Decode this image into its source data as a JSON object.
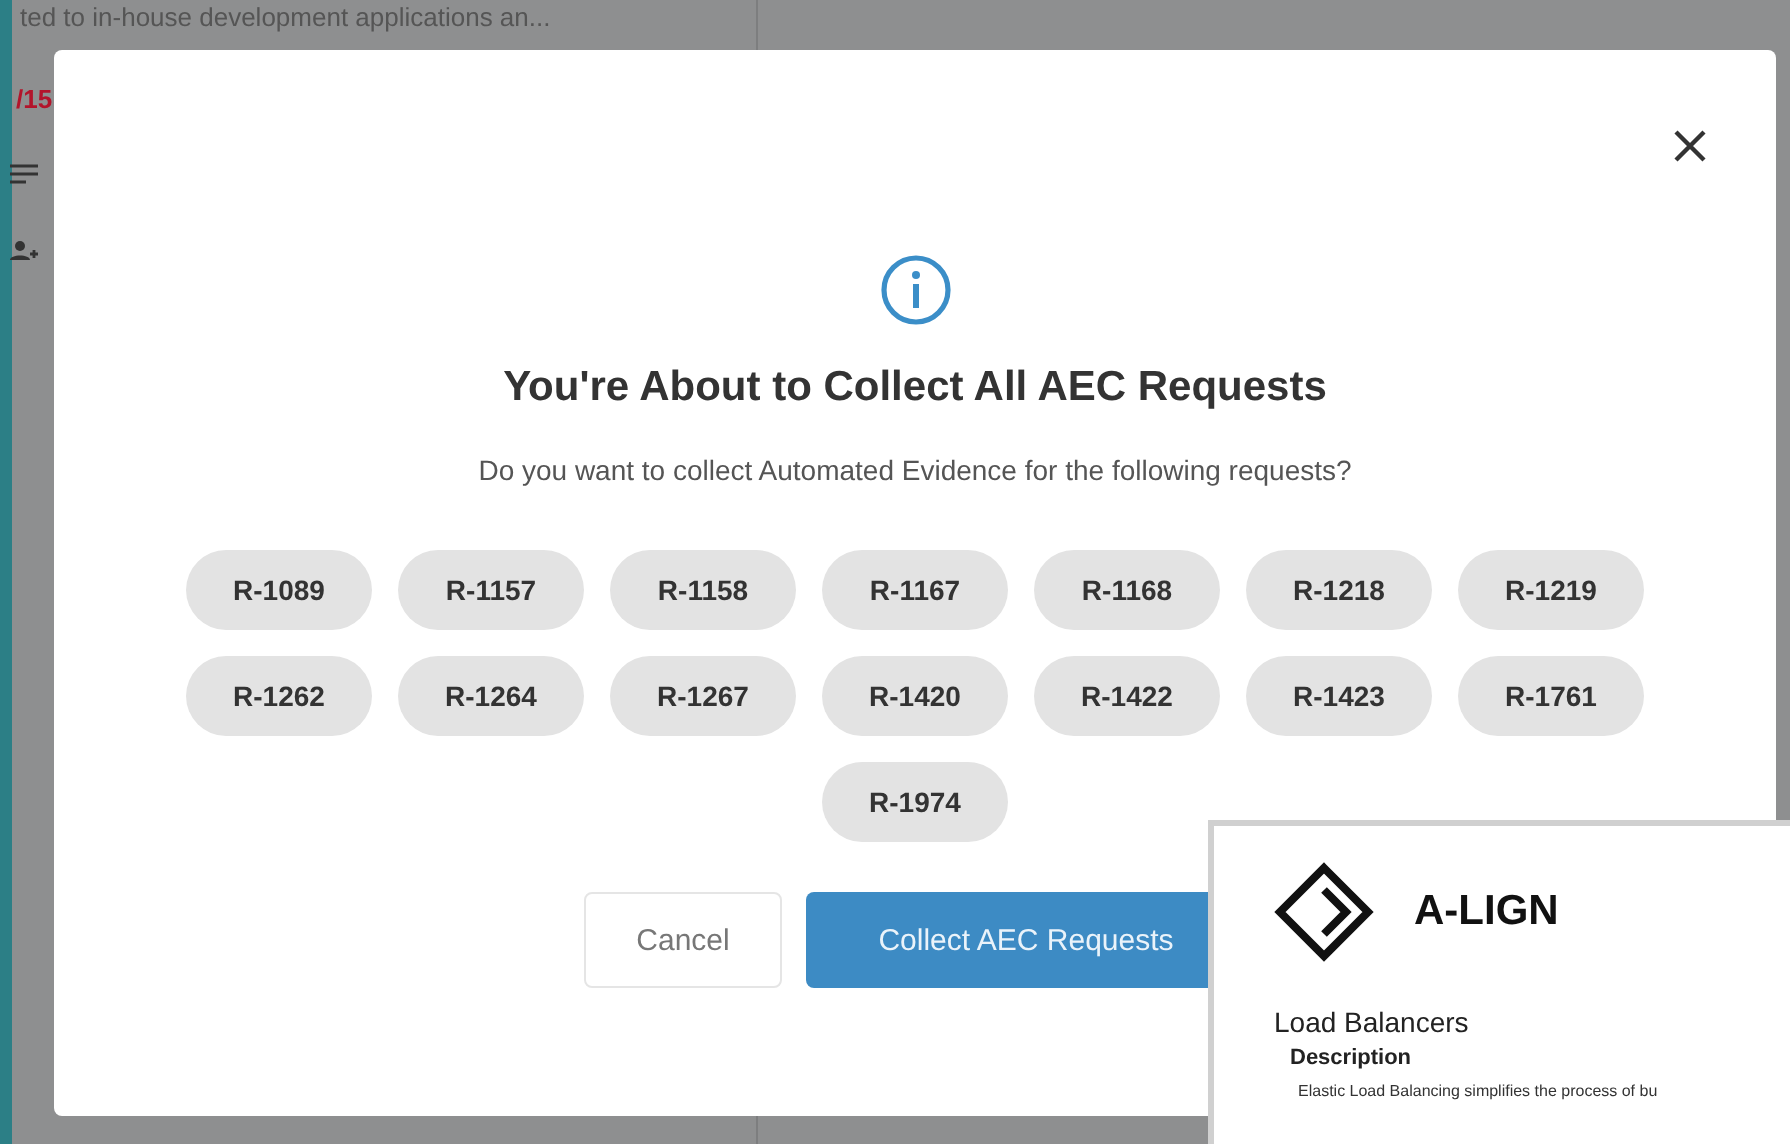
{
  "background": {
    "snippet": "ted to in-house development applications an...",
    "date": "/15"
  },
  "dialog": {
    "title": "You're About to Collect All AEC Requests",
    "message": "Do you want to collect Automated Evidence for the following requests?",
    "requests": [
      "R-1089",
      "R-1157",
      "R-1158",
      "R-1167",
      "R-1168",
      "R-1218",
      "R-1219",
      "R-1262",
      "R-1264",
      "R-1267",
      "R-1420",
      "R-1422",
      "R-1423",
      "R-1761",
      "R-1974"
    ],
    "buttons": [
      {
        "label": "Cancel",
        "kind": "secondary"
      },
      {
        "label": "Collect AEC Requests",
        "kind": "primary"
      }
    ]
  },
  "document": {
    "brand": "A-LIGN",
    "heading": "Load Balancers",
    "subheading": "Description",
    "text": "Elastic Load Balancing simplifies the process of bu"
  }
}
